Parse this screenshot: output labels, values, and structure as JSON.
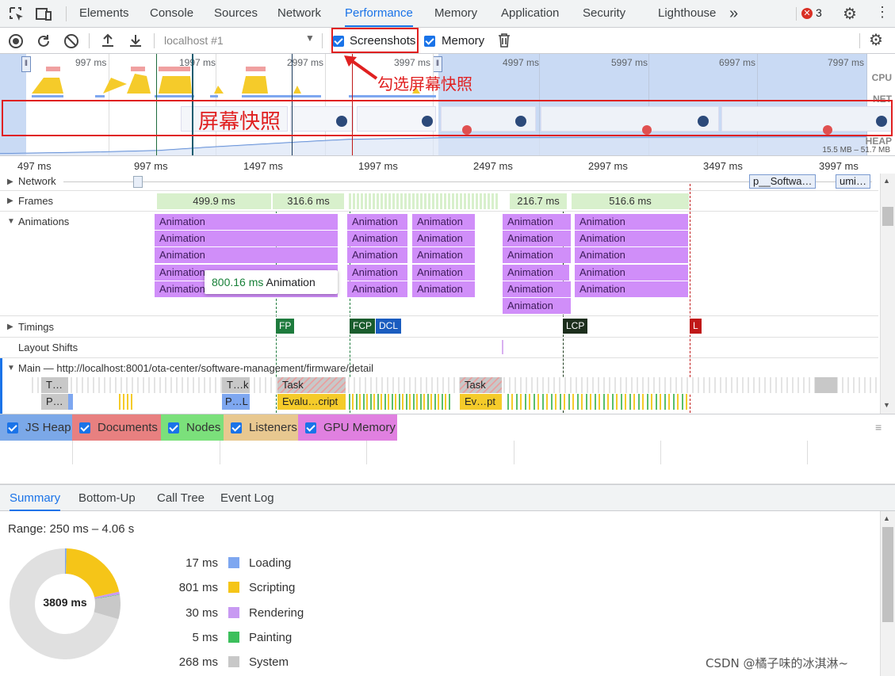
{
  "tabs": [
    {
      "label": "Elements"
    },
    {
      "label": "Console"
    },
    {
      "label": "Sources"
    },
    {
      "label": "Network"
    },
    {
      "label": "Performance"
    },
    {
      "label": "Memory"
    },
    {
      "label": "Application"
    },
    {
      "label": "Security"
    },
    {
      "label": "Lighthouse"
    }
  ],
  "tab_more": "»",
  "error_count": "3",
  "toolbar": {
    "target": "localhost #1",
    "screenshots_label": "Screenshots",
    "memory_label": "Memory"
  },
  "overview": {
    "ticks": [
      "997 ms",
      "1997 ms",
      "2997 ms",
      "3997 ms",
      "4997 ms",
      "5997 ms",
      "6997 ms",
      "7997 ms"
    ],
    "side_labels": {
      "cpu": "CPU",
      "net": "NET",
      "heap": "HEAP"
    },
    "heap_range": "15.5 MB – 51.7 MB"
  },
  "annotations": {
    "checkbox_hint": "勾选屏幕快照",
    "screenshots_hint": "屏幕快照"
  },
  "ruler": [
    "497 ms",
    "997 ms",
    "1497 ms",
    "1997 ms",
    "2497 ms",
    "2997 ms",
    "3497 ms",
    "3997 ms"
  ],
  "tracks": {
    "network": "Network",
    "network_items": [
      "p__Softwa…",
      "umi…"
    ],
    "frames": "Frames",
    "frame_values": [
      "499.9 ms",
      "316.6 ms",
      "216.7 ms",
      "516.6 ms"
    ],
    "animations": "Animations",
    "animation_label": "Animation",
    "tooltip_time": "800.16 ms",
    "tooltip_label": "Animation",
    "timings": "Timings",
    "timing_markers": [
      "FP",
      "FCP",
      "DCL",
      "LCP",
      "L"
    ],
    "layout_shifts": "Layout Shifts",
    "main": "Main — http://localhost:8001/ota-center/software-management/firmware/detail",
    "main_tasks": [
      "T…",
      "T…k",
      "Task",
      "Task"
    ],
    "main_sub": [
      "P…",
      "P…L",
      "Evalu…cript",
      "Ev…pt"
    ]
  },
  "memory_counters": [
    {
      "label": "JS Heap",
      "color": "#7ba8e8"
    },
    {
      "label": "Documents",
      "color": "#e88080"
    },
    {
      "label": "Nodes",
      "color": "#7be07b"
    },
    {
      "label": "Listeners",
      "color": "#e8c890"
    },
    {
      "label": "GPU Memory",
      "color": "#e080e0"
    }
  ],
  "summary": {
    "tabs": [
      "Summary",
      "Bottom-Up",
      "Call Tree",
      "Event Log"
    ],
    "range": "Range: 250 ms – 4.06 s",
    "total": "3809 ms",
    "legend": [
      {
        "value": "17 ms",
        "label": "Loading",
        "color": "#7ea7f0"
      },
      {
        "value": "801 ms",
        "label": "Scripting",
        "color": "#f5c518"
      },
      {
        "value": "30 ms",
        "label": "Rendering",
        "color": "#c89af2"
      },
      {
        "value": "5 ms",
        "label": "Painting",
        "color": "#3cbf5c"
      },
      {
        "value": "268 ms",
        "label": "System",
        "color": "#c8c8c8"
      }
    ]
  },
  "watermark": "CSDN @橘子味的冰淇淋~"
}
